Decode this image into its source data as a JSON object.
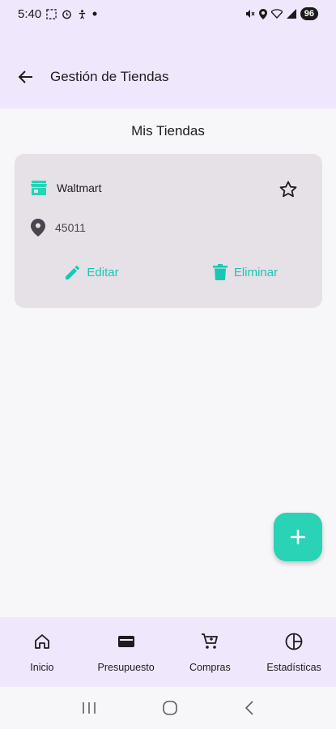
{
  "status_bar": {
    "time": "5:40",
    "battery": "96",
    "left_icons": [
      "screenshot-icon",
      "alarm-icon",
      "accessibility-icon",
      "dot-icon"
    ],
    "right_icons": [
      "mute-icon",
      "location-icon",
      "wifi-icon",
      "signal-icon"
    ]
  },
  "app_bar": {
    "title": "Gestión de Tiendas",
    "back_icon": "arrow-back-icon"
  },
  "section_title": "Mis Tiendas",
  "store": {
    "name": "Waltmart",
    "location": "45011",
    "favorite": false,
    "edit_label": "Editar",
    "delete_label": "Eliminar"
  },
  "fab": {
    "icon": "plus-icon"
  },
  "bottom_nav": {
    "items": [
      {
        "label": "Inicio",
        "icon": "home-icon"
      },
      {
        "label": "Presupuesto",
        "icon": "wallet-icon"
      },
      {
        "label": "Compras",
        "icon": "cart-icon"
      },
      {
        "label": "Estadísticas",
        "icon": "pie-chart-icon"
      }
    ]
  },
  "colors": {
    "accent": "#2ad2b6",
    "app_bar_bg": "#efe7fb",
    "card_bg": "#e6e0e7",
    "background": "#f7f6f9"
  }
}
